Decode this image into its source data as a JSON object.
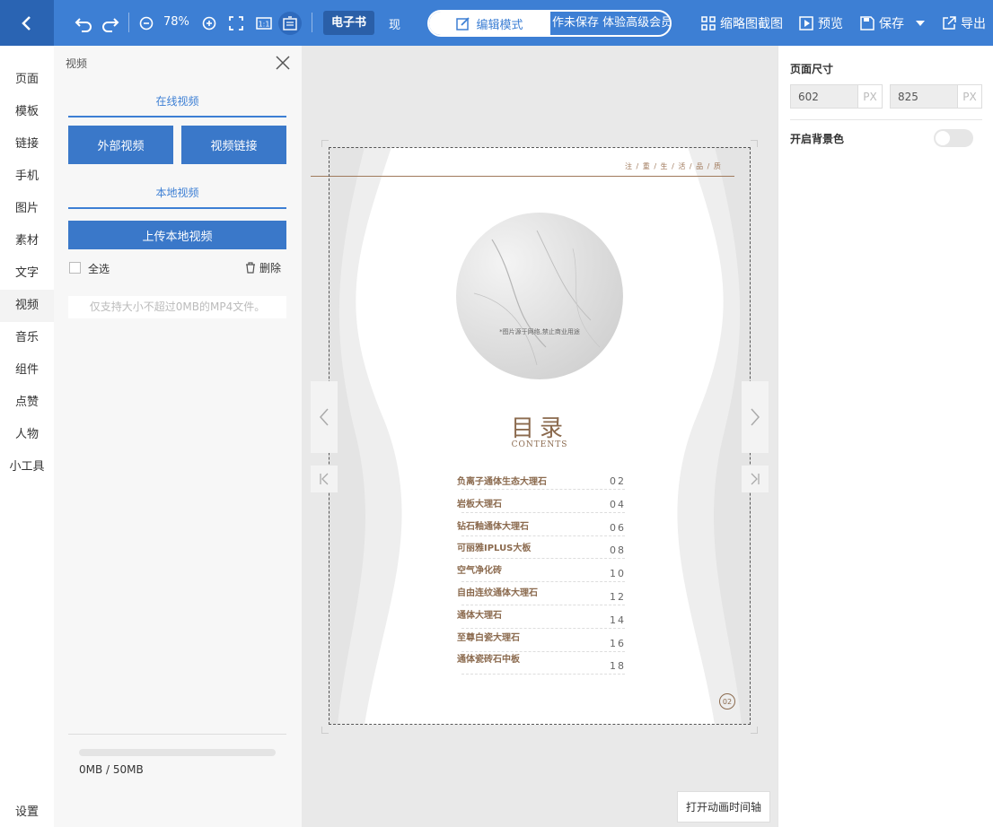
{
  "toolbar": {
    "zoom": "78%",
    "ebook_label": "电子书",
    "other_label": "现",
    "mode_edit": "编辑模式",
    "mode_other_text": "作未保存 体验高级会员",
    "thumbnail": "缩略图截图",
    "preview": "预览",
    "save": "保存",
    "export": "导出"
  },
  "nav": {
    "items": [
      "页面",
      "模板",
      "链接",
      "手机",
      "图片",
      "素材",
      "文字",
      "视频",
      "音乐",
      "组件",
      "点赞",
      "人物",
      "小工具"
    ],
    "active_index": 7,
    "settings": "设置"
  },
  "panel": {
    "title": "视频",
    "online_title": "在线视频",
    "external_btn": "外部视频",
    "link_btn": "视频链接",
    "local_title": "本地视频",
    "upload_btn": "上传本地视频",
    "select_all": "全选",
    "delete": "删除",
    "hint": "仅支持大小不超过0MB的MP4文件。",
    "storage_text": "0MB / 50MB",
    "storage_fraction": 0
  },
  "page": {
    "slogan": "注 / 重 / 生 / 活 / 品 / 质",
    "image_note": "*图片源于网络,禁止商业用途",
    "toc_title": "目录",
    "toc_sub": "CONTENTS",
    "toc": [
      {
        "name": "负离子通体生态大理石",
        "num": "02"
      },
      {
        "name": "岩板大理石",
        "num": "04"
      },
      {
        "name": "钻石釉通体大理石",
        "num": "06"
      },
      {
        "name": "可丽雅IPLUS大板",
        "num": "08"
      },
      {
        "name": "空气净化砖",
        "num": "10"
      },
      {
        "name": "自由连纹通体大理石",
        "num": "12"
      },
      {
        "name": "通体大理石",
        "num": "14"
      },
      {
        "name": "至尊白瓷大理石",
        "num": "16"
      },
      {
        "name": "通体瓷砖石中板",
        "num": "18"
      }
    ],
    "page_number": "02"
  },
  "canvas": {
    "timeline_btn": "打开动画时间轴"
  },
  "right": {
    "size_label": "页面尺寸",
    "width": "602",
    "height": "825",
    "unit": "PX",
    "bg_label": "开启背景色",
    "bg_enabled": false
  },
  "colors": {
    "accent": "#3d7fd4",
    "brown": "#8b6a4e"
  }
}
